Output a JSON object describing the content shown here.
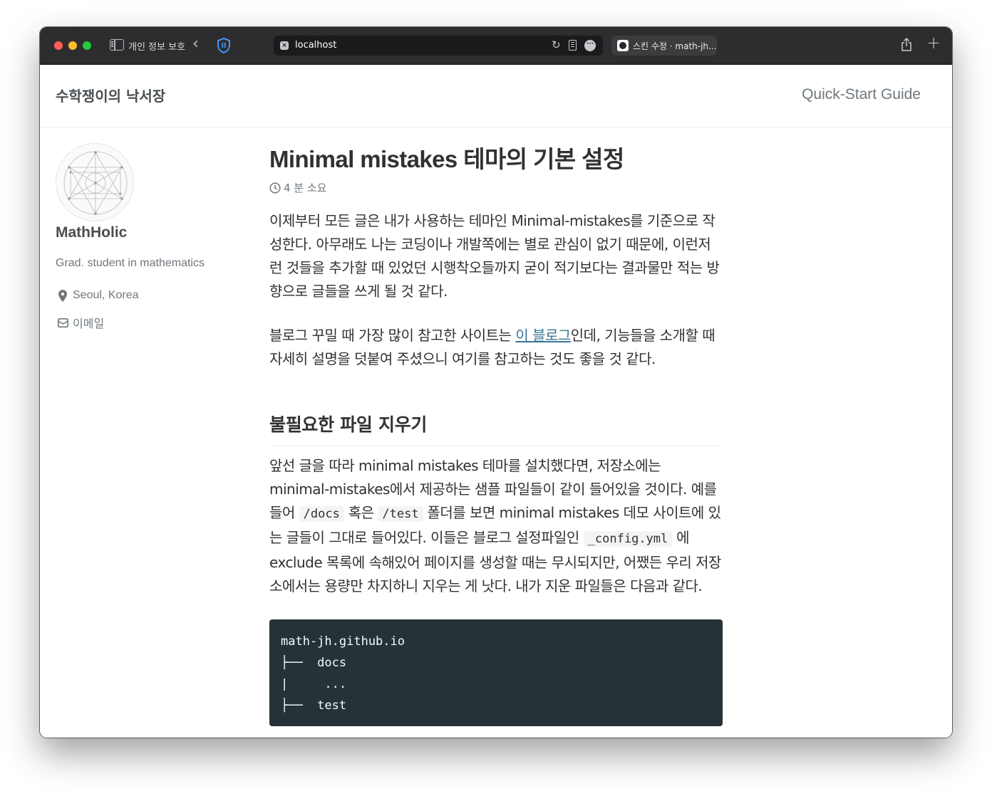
{
  "browser": {
    "private_label": "개인 정보 보호",
    "url": "localhost",
    "tab2_title": "스킨 수정 · math-jh...",
    "colors": {
      "chrome": "#2d2d2f",
      "addressbar": "#1b1b1d",
      "close": "#ff5f57",
      "minimize": "#febc2e",
      "zoom": "#28c840"
    }
  },
  "masthead": {
    "site_title": "수학쟁이의 낙서장",
    "nav_link": "Quick-Start Guide"
  },
  "author": {
    "name": "MathHolic",
    "bio": "Grad. student in mathematics",
    "location": "Seoul, Korea",
    "email_label": "이메일"
  },
  "post": {
    "title": "Minimal mistakes 테마의 기본 설정",
    "read_time": "4 분 소요",
    "intro": "이제부터 모든 글은 내가 사용하는 테마인 Minimal-mistakes를 기준으로 작성한다. 아무래도 나는 코딩이나 개발쪽에는 별로 관심이 없기 때문에, 이런저런 것들을 추가할 때 있었던 시행착오들까지 굳이 적기보다는 결과물만 적는 방향으로 글들을 쓰게 될 것 같다.",
    "ref_before": "블로그 꾸밀 때 가장 많이 참고한 사이트는 ",
    "ref_link": "이 블로그",
    "ref_after": "인데, 기능들을 소개할 때 자세히 설명을 덧붙여 주셨으니 여기를 참고하는 것도 좋을 것 같다.",
    "section_title": "불필요한 파일 지우기",
    "body_1": "앞선 글을 따라 minimal mistakes 테마를 설치했다면, 저장소에는 minimal-mistakes에서 제공하는 샘플 파일들이 같이 들어있을 것이다. 예를 들어 ",
    "code_docs": "/docs",
    "body_2": " 혹은 ",
    "code_test": "/test",
    "body_3": " 폴더를 보면 minimal mistakes 데모 사이트에 있는 글들이 그대로 들어있다. 이들은 블로그 설정파일인 ",
    "code_config": "_config.yml",
    "body_4": " 에 exclude 목록에 속해있어 페이지를 생성할 때는 무시되지만, 어쨌든 우리 저장소에서는 용량만 차지하니 지우는 게 낫다. 내가 지운 파일들은 다음과 같다.",
    "code_lines": [
      "math-jh.github.io",
      "├──  docs",
      "|     ...",
      "├──  test"
    ]
  }
}
